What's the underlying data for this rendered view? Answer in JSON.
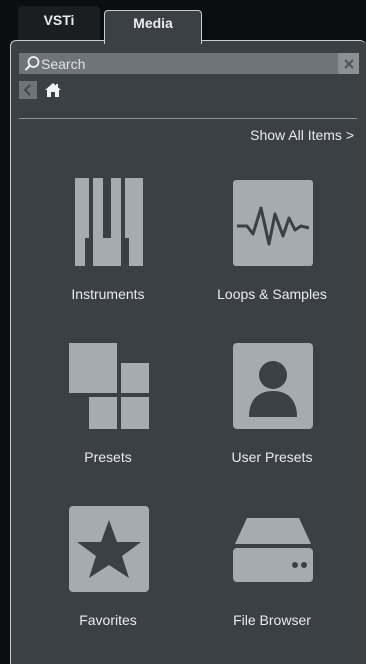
{
  "tabs": [
    {
      "label": "VSTi",
      "active": false
    },
    {
      "label": "Media",
      "active": true
    }
  ],
  "search": {
    "placeholder": "Search",
    "value": ""
  },
  "nav": {
    "back_icon": "back-arrow-icon",
    "home_icon": "home-icon"
  },
  "show_all_label": "Show All Items >",
  "tiles": [
    {
      "label": "Instruments",
      "icon": "piano-keys-icon"
    },
    {
      "label": "Loops & Samples",
      "icon": "waveform-icon"
    },
    {
      "label": "Presets",
      "icon": "presets-blocks-icon"
    },
    {
      "label": "User Presets",
      "icon": "user-icon"
    },
    {
      "label": "Favorites",
      "icon": "star-icon"
    },
    {
      "label": "File Browser",
      "icon": "disk-drive-icon"
    }
  ],
  "colors": {
    "panel": "#3b4045",
    "icon_fill": "#a6abb0",
    "icon_dark": "#3b4045",
    "text": "#e9ecee"
  }
}
